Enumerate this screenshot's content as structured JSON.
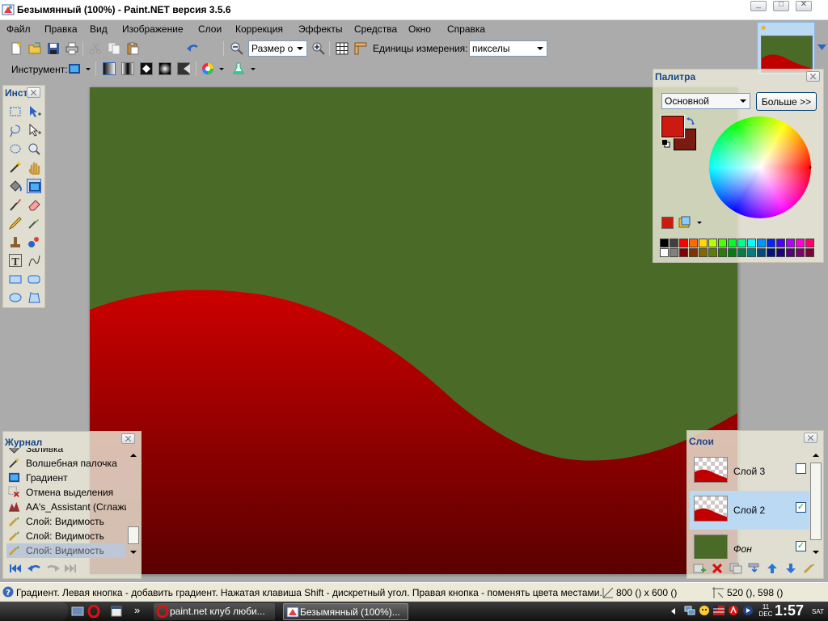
{
  "window": {
    "title": "Безымянный (100%) - Paint.NET версия 3.5.6",
    "buttons": [
      "minimize",
      "maximize",
      "close"
    ]
  },
  "menu": [
    "Файл",
    "Правка",
    "Вид",
    "Изображение",
    "Слои",
    "Коррекция",
    "Эффекты",
    "Средства",
    "Окно",
    "Справка"
  ],
  "toolbar": {
    "zoom_combo_value": "Размер окна",
    "units_label": "Единицы измерения:",
    "units_value": "пикселы",
    "tool_label": "Инструмент:"
  },
  "tools_panel": {
    "title": "Инструменты",
    "tools": [
      "rectangle-select",
      "move-selection",
      "lasso-select",
      "move-selected",
      "ellipse-select",
      "zoom",
      "magic-wand",
      "pan",
      "paint-bucket",
      "gradient",
      "paintbrush",
      "eraser",
      "pencil",
      "color-picker",
      "clone-stamp",
      "recolor",
      "text",
      "line-curve",
      "rectangle",
      "rounded-rectangle",
      "ellipse",
      "freeform-shape"
    ],
    "selected": "gradient"
  },
  "palette_panel": {
    "title": "Палитра",
    "mode_value": "Основной",
    "more_button": "Больше >>",
    "primary_color": "#cc1a10",
    "secondary_color": "#7a1a10",
    "swatches_row1": [
      "#000000",
      "#404040",
      "#ff0000",
      "#ff6a00",
      "#ffd800",
      "#b6ff00",
      "#4cff00",
      "#00ff21",
      "#00ff90",
      "#00ffff",
      "#0094ff",
      "#0026ff",
      "#4800ff",
      "#b200ff",
      "#ff00dc",
      "#ff006e"
    ],
    "swatches_row2": [
      "#ffffff",
      "#808080",
      "#7f0000",
      "#7f3300",
      "#7f6a00",
      "#5b7f00",
      "#267f00",
      "#007f0e",
      "#007f46",
      "#007f7f",
      "#004a7f",
      "#00137f",
      "#21007f",
      "#57007f",
      "#7f006e",
      "#7f0037"
    ]
  },
  "history_panel": {
    "title": "Журнал",
    "items": [
      {
        "label": "Заливка",
        "icon": "paint-bucket-icon"
      },
      {
        "label": "Волшебная палочка",
        "icon": "magic-wand-icon"
      },
      {
        "label": "Градиент",
        "icon": "gradient-icon"
      },
      {
        "label": "Отмена выделения",
        "icon": "deselect-icon"
      },
      {
        "label": "AA's_Assistant (Сглажи...",
        "icon": "plugin-icon"
      },
      {
        "label": "Слой: Видимость",
        "icon": "layer-visibility-icon"
      },
      {
        "label": "Слой: Видимость",
        "icon": "layer-visibility-icon"
      },
      {
        "label": "Слой: Видимость",
        "icon": "layer-visibility-icon"
      }
    ],
    "selected_index": 7
  },
  "layers_panel": {
    "title": "Слои",
    "layers": [
      {
        "name": "Слой 3",
        "visible": false
      },
      {
        "name": "Слой 2",
        "visible": true
      },
      {
        "name": "Фон",
        "visible": true
      }
    ],
    "selected_index": 1
  },
  "canvas": {
    "background_color": "#4a6b28",
    "wave_color_top": "#cc0000",
    "wave_color_bottom": "#5a0000"
  },
  "statusbar": {
    "hint": "Градиент. Левая кнопка - добавить градиент. Нажатая клавиша Shift - дискретный угол. Правая кнопка - поменять цвета местами.",
    "image_size": "800 () x 600 ()",
    "cursor_pos": "520 (), 598 ()"
  },
  "taskbar": {
    "quick_launch_more": "»",
    "tasks": [
      {
        "label": "paint.net клуб люби...",
        "icon": "opera-icon"
      },
      {
        "label": "Безымянный (100%)...",
        "icon": "paintnet-icon"
      }
    ],
    "clock": {
      "day": "11",
      "month": "DEC",
      "time": "1:57",
      "weekday": "SAT"
    }
  }
}
